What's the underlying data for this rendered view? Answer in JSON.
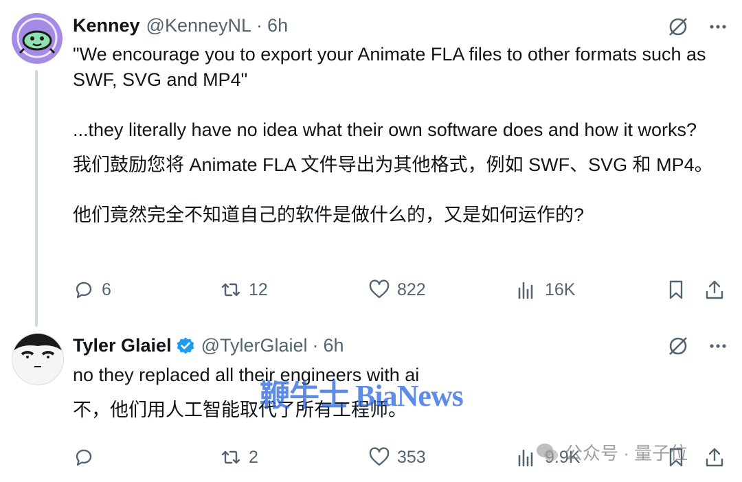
{
  "tweet1": {
    "author_name": "Kenney",
    "handle": "@KenneyNL",
    "separator": "·",
    "time": "6h",
    "text_en_1": "\"We encourage you to export your Animate FLA files to other formats such as SWF, SVG and MP4\"",
    "text_en_2": "...they literally have no idea what their own software does and how it works?",
    "text_cn_1": "我们鼓励您将 Animate FLA 文件导出为其他格式，例如 SWF、SVG 和 MP4。",
    "text_cn_2": "他们竟然完全不知道自己的软件是做什么的，又是如何运作的?",
    "stats": {
      "replies": "6",
      "reposts": "12",
      "likes": "822",
      "views": "16K"
    }
  },
  "tweet2": {
    "author_name": "Tyler Glaiel",
    "handle": "@TylerGlaiel",
    "separator": "·",
    "time": "6h",
    "text_en": "no they replaced all their engineers with ai",
    "text_cn": "不，他们用人工智能取代了所有工程师。",
    "stats": {
      "replies": "",
      "reposts": "2",
      "likes": "353",
      "views": "9.9K"
    }
  },
  "watermarks": {
    "overlay": "鞭牛士 BiaNews",
    "wechat": "公众号 · 量子位"
  },
  "colors": {
    "text": "#0f1419",
    "muted": "#536471",
    "verified": "#1d9bf0",
    "avatar_kenney_bg": "#a58be6"
  },
  "icons": [
    "grok-icon",
    "more-icon",
    "reply-icon",
    "repost-icon",
    "like-icon",
    "views-icon",
    "bookmark-icon",
    "share-icon",
    "verified-badge-icon"
  ]
}
